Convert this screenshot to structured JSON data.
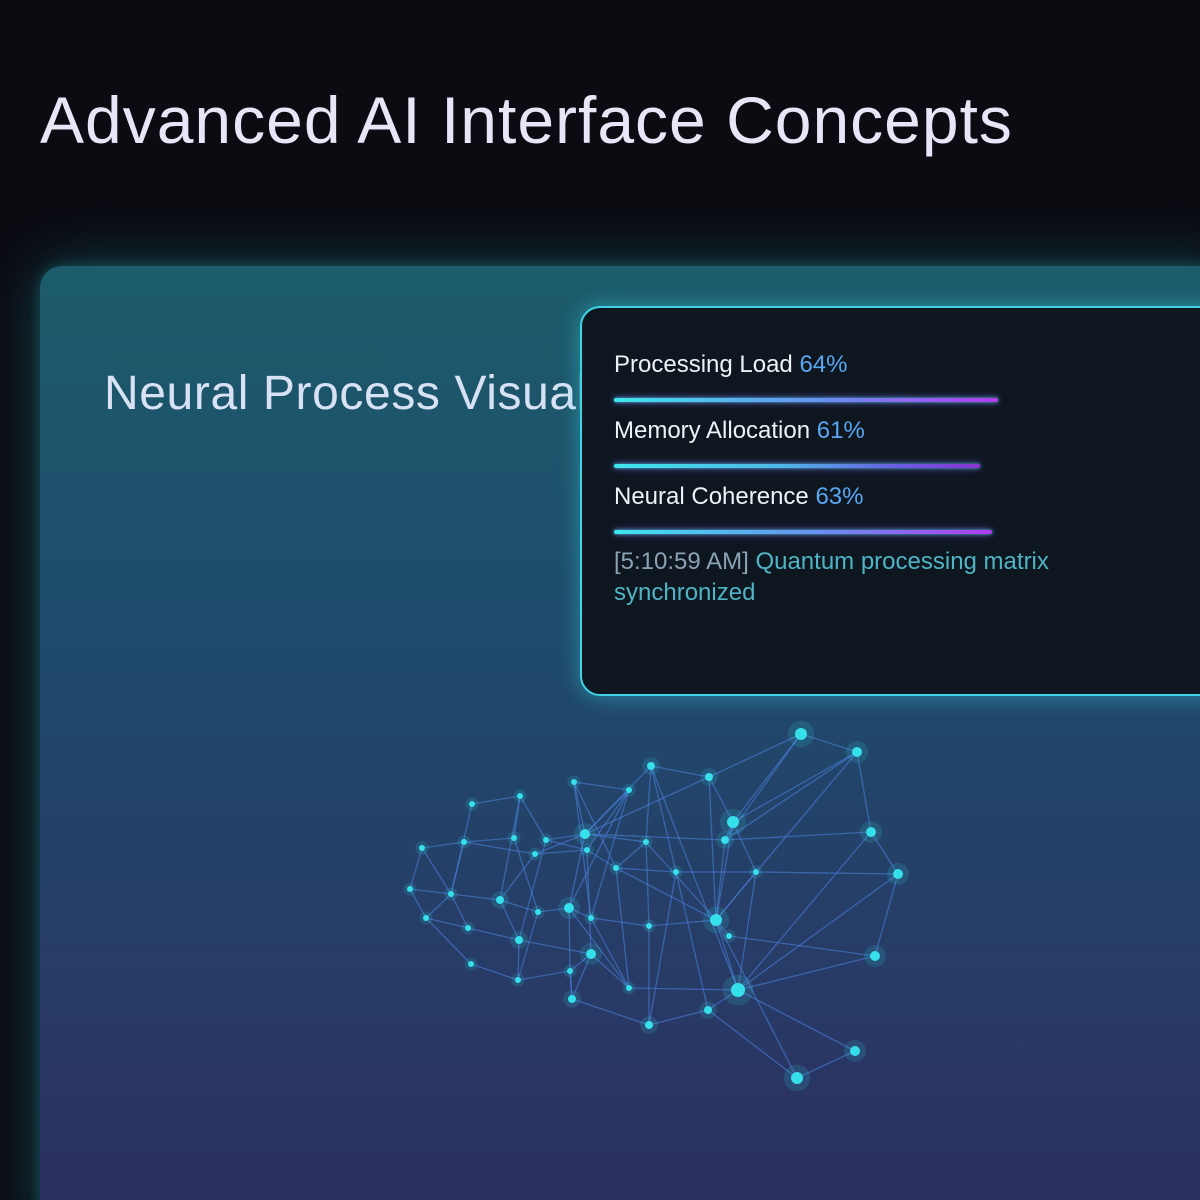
{
  "page": {
    "title": "Advanced AI Interface Concepts"
  },
  "panel": {
    "title": "Neural Process Visualization"
  },
  "metrics": [
    {
      "label": "Processing Load",
      "value": "64%",
      "fraction": 0.64
    },
    {
      "label": "Memory Allocation",
      "value": "61%",
      "fraction": 0.61
    },
    {
      "label": "Neural Coherence",
      "value": "63%",
      "fraction": 0.63
    }
  ],
  "log": {
    "time": "[5:10:59 AM]",
    "message": "Quantum processing matrix synchronized"
  },
  "colors": {
    "background": "#0b0b12",
    "accent_cyan": "#3fd3e3",
    "accent_purple": "#b53cf0",
    "value_blue": "#5aa6f0",
    "node": "#36e0ea",
    "link": "#4a7fd8"
  }
}
